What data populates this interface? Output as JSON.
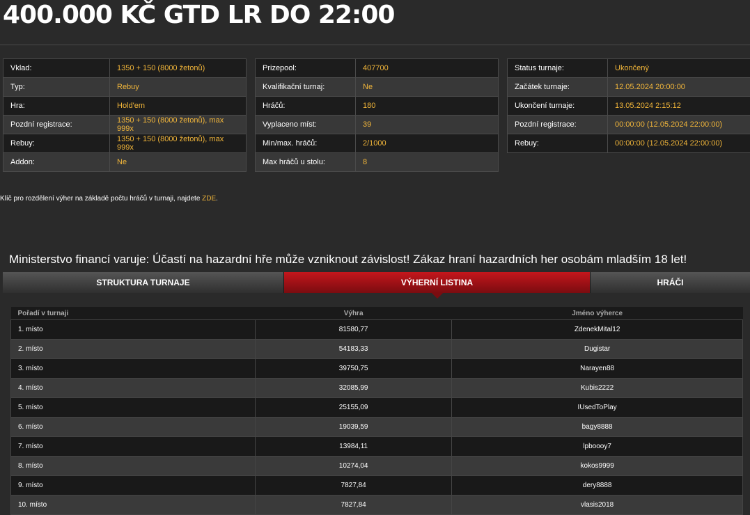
{
  "title": "400.000 KČ GTD LR DO 22:00",
  "info_tables": [
    [
      {
        "label": "Vklad:",
        "value": "1350 + 150 (8000 žetonů)"
      },
      {
        "label": "Typ:",
        "value": "Rebuy"
      },
      {
        "label": "Hra:",
        "value": "Hold'em"
      },
      {
        "label": "Pozdní registrace:",
        "value": "1350 + 150 (8000 žetonů), max 999x"
      },
      {
        "label": "Rebuy:",
        "value": "1350 + 150 (8000 žetonů), max 999x"
      },
      {
        "label": "Addon:",
        "value": "Ne"
      }
    ],
    [
      {
        "label": "Prizepool:",
        "value": "407700"
      },
      {
        "label": "Kvalifikační turnaj:",
        "value": "Ne"
      },
      {
        "label": "Hráčů:",
        "value": "180"
      },
      {
        "label": "Vyplaceno míst:",
        "value": "39"
      },
      {
        "label": "Min/max. hráčů:",
        "value": "2/1000"
      },
      {
        "label": "Max hráčů u stolu:",
        "value": "8"
      }
    ],
    [
      {
        "label": "Status turnaje:",
        "value": "Ukončený"
      },
      {
        "label": "Začátek turnaje:",
        "value": "12.05.2024 20:00:00"
      },
      {
        "label": "Ukončení turnaje:",
        "value": "13.05.2024 2:15:12"
      },
      {
        "label": "Pozdní registrace:",
        "value": "00:00:00 (12.05.2024 22:00:00)"
      },
      {
        "label": "Rebuy:",
        "value": "00:00:00 (12.05.2024 22:00:00)"
      }
    ]
  ],
  "note": {
    "text": "Klíč pro rozdělení výher na základě počtu hráčů v turnaji, najdete ",
    "link": "ZDE",
    "suffix": "."
  },
  "warning": "Ministerstvo financí varuje: Účastí na hazardní hře může vzniknout závislost! Zákaz hraní hazardních her osobám mladším 18 let!",
  "tabs": [
    {
      "label": "STRUKTURA TURNAJE",
      "active": false
    },
    {
      "label": "VÝHERNÍ LISTINA",
      "active": true
    },
    {
      "label": "HRÁČI",
      "active": false
    }
  ],
  "results": {
    "headers": [
      "Pořadí v turnaji",
      "Výhra",
      "Jméno výherce"
    ],
    "rows": [
      [
        "1. místo",
        "81580,77",
        "ZdenekMital12"
      ],
      [
        "2. místo",
        "54183,33",
        "Dugistar"
      ],
      [
        "3. místo",
        "39750,75",
        "Narayen88"
      ],
      [
        "4. místo",
        "32085,99",
        "Kubis2222"
      ],
      [
        "5. místo",
        "25155,09",
        "IUsedToPlay"
      ],
      [
        "6. místo",
        "19039,59",
        "bagy8888"
      ],
      [
        "7. místo",
        "13984,11",
        "lpboooy7"
      ],
      [
        "8. místo",
        "10274,04",
        "kokos9999"
      ],
      [
        "9. místo",
        "7827,84",
        "dery8888"
      ],
      [
        "10. místo",
        "7827,84",
        "vlasis2018"
      ]
    ]
  },
  "colors": {
    "accent": "#f2b63a",
    "active_tab": "#c4161c"
  }
}
